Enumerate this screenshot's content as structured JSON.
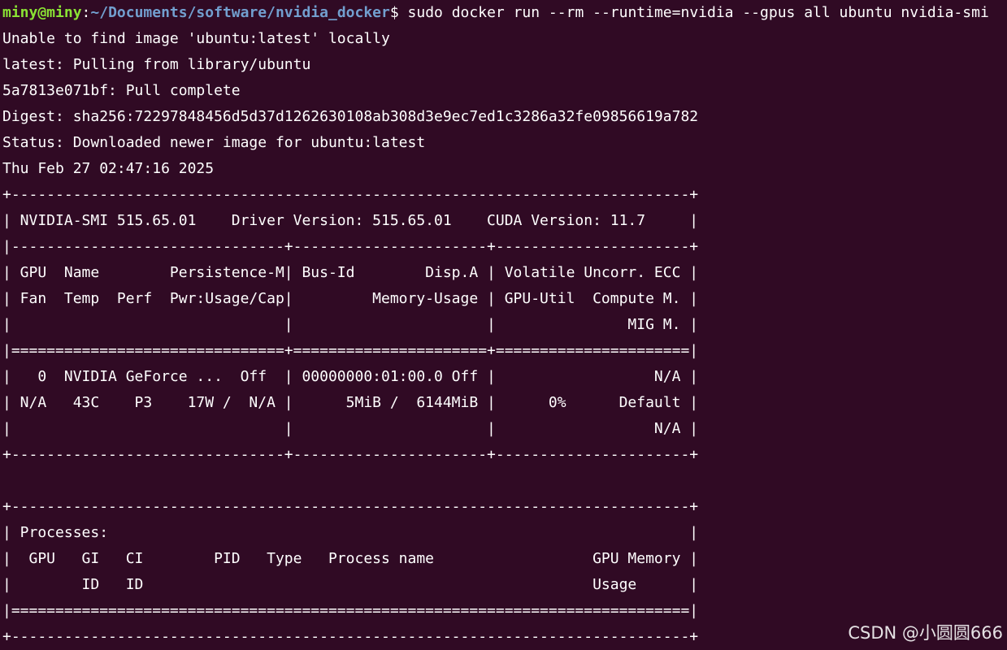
{
  "colors": {
    "background": "#300a24",
    "text": "#ffffff",
    "user_host": "#8ae234",
    "working_directory": "#729fcf"
  },
  "prompt": {
    "user_host": "miny@miny",
    "separator": ":",
    "working_directory": "~/Documents/software/nvidia_docker",
    "symbol": "$",
    "command": " sudo docker run --rm --runtime=nvidia --gpus all ubuntu nvidia-smi"
  },
  "output_lines": [
    "Unable to find image 'ubuntu:latest' locally",
    "latest: Pulling from library/ubuntu",
    "5a7813e071bf: Pull complete",
    "Digest: sha256:72297848456d5d37d1262630108ab308d3e9ec7ed1c3286a32fe09856619a782",
    "Status: Downloaded newer image for ubuntu:latest",
    "Thu Feb 27 02:47:16 2025",
    "+-----------------------------------------------------------------------------+",
    "| NVIDIA-SMI 515.65.01    Driver Version: 515.65.01    CUDA Version: 11.7     |",
    "|-------------------------------+----------------------+----------------------+",
    "| GPU  Name        Persistence-M| Bus-Id        Disp.A | Volatile Uncorr. ECC |",
    "| Fan  Temp  Perf  Pwr:Usage/Cap|         Memory-Usage | GPU-Util  Compute M. |",
    "|                               |                      |               MIG M. |",
    "|===============================+======================+======================|",
    "|   0  NVIDIA GeForce ...  Off  | 00000000:01:00.0 Off |                  N/A |",
    "| N/A   43C    P3    17W /  N/A |      5MiB /  6144MiB |      0%      Default |",
    "|                               |                      |                  N/A |",
    "+-------------------------------+----------------------+----------------------+",
    "",
    "+-----------------------------------------------------------------------------+",
    "| Processes:                                                                  |",
    "|  GPU   GI   CI        PID   Type   Process name                  GPU Memory |",
    "|        ID   ID                                                   Usage      |",
    "|=============================================================================|",
    "+-----------------------------------------------------------------------------+"
  ],
  "watermark": "CSDN @小圆圆666"
}
